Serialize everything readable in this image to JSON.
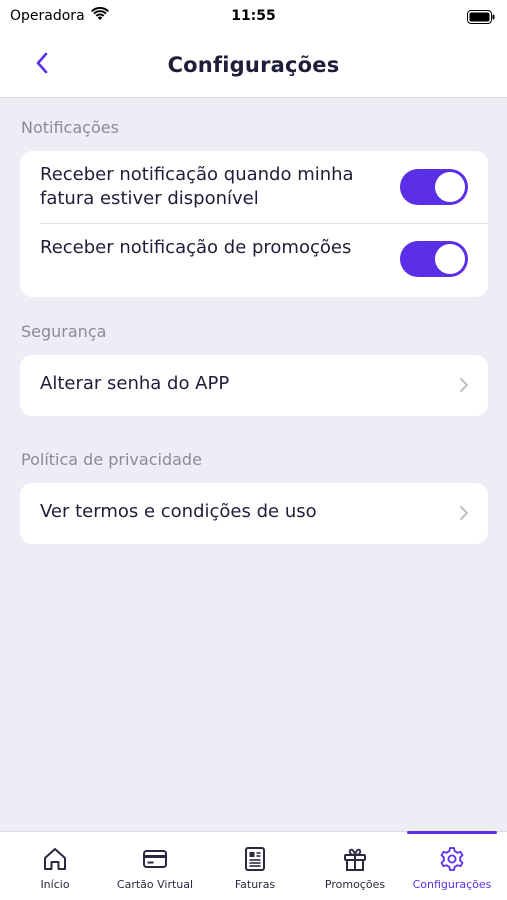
{
  "status_bar": {
    "carrier": "Operadora",
    "time": "11:55",
    "icons": [
      "wifi-icon",
      "battery-icon"
    ]
  },
  "navbar": {
    "title": "Configurações",
    "back_icon": "chevron-left-icon"
  },
  "sections": {
    "notifications": {
      "label": "Notificações",
      "rows": [
        {
          "text": "Receber notificação quando minha fatura estiver disponível",
          "enabled": true
        },
        {
          "text": "Receber notificação de promoções",
          "enabled": true
        }
      ]
    },
    "security": {
      "label": "Segurança",
      "item": "Alterar senha do APP"
    },
    "privacy": {
      "label": "Política de privacidade",
      "item": "Ver termos e condições de uso"
    }
  },
  "tabbar": {
    "tabs": [
      {
        "label": "Início",
        "icon": "home-icon"
      },
      {
        "label": "Cartão Virtual",
        "icon": "credit-card-icon"
      },
      {
        "label": "Faturas",
        "icon": "receipt-icon"
      },
      {
        "label": "Promoções",
        "icon": "gift-icon"
      },
      {
        "label": "Configurações",
        "icon": "gear-icon"
      }
    ],
    "active_index": 4
  },
  "colors": {
    "accent": "#5b2ee8",
    "background": "#ecedf5",
    "text": "#1f1e3a",
    "muted": "#8b8b99"
  }
}
